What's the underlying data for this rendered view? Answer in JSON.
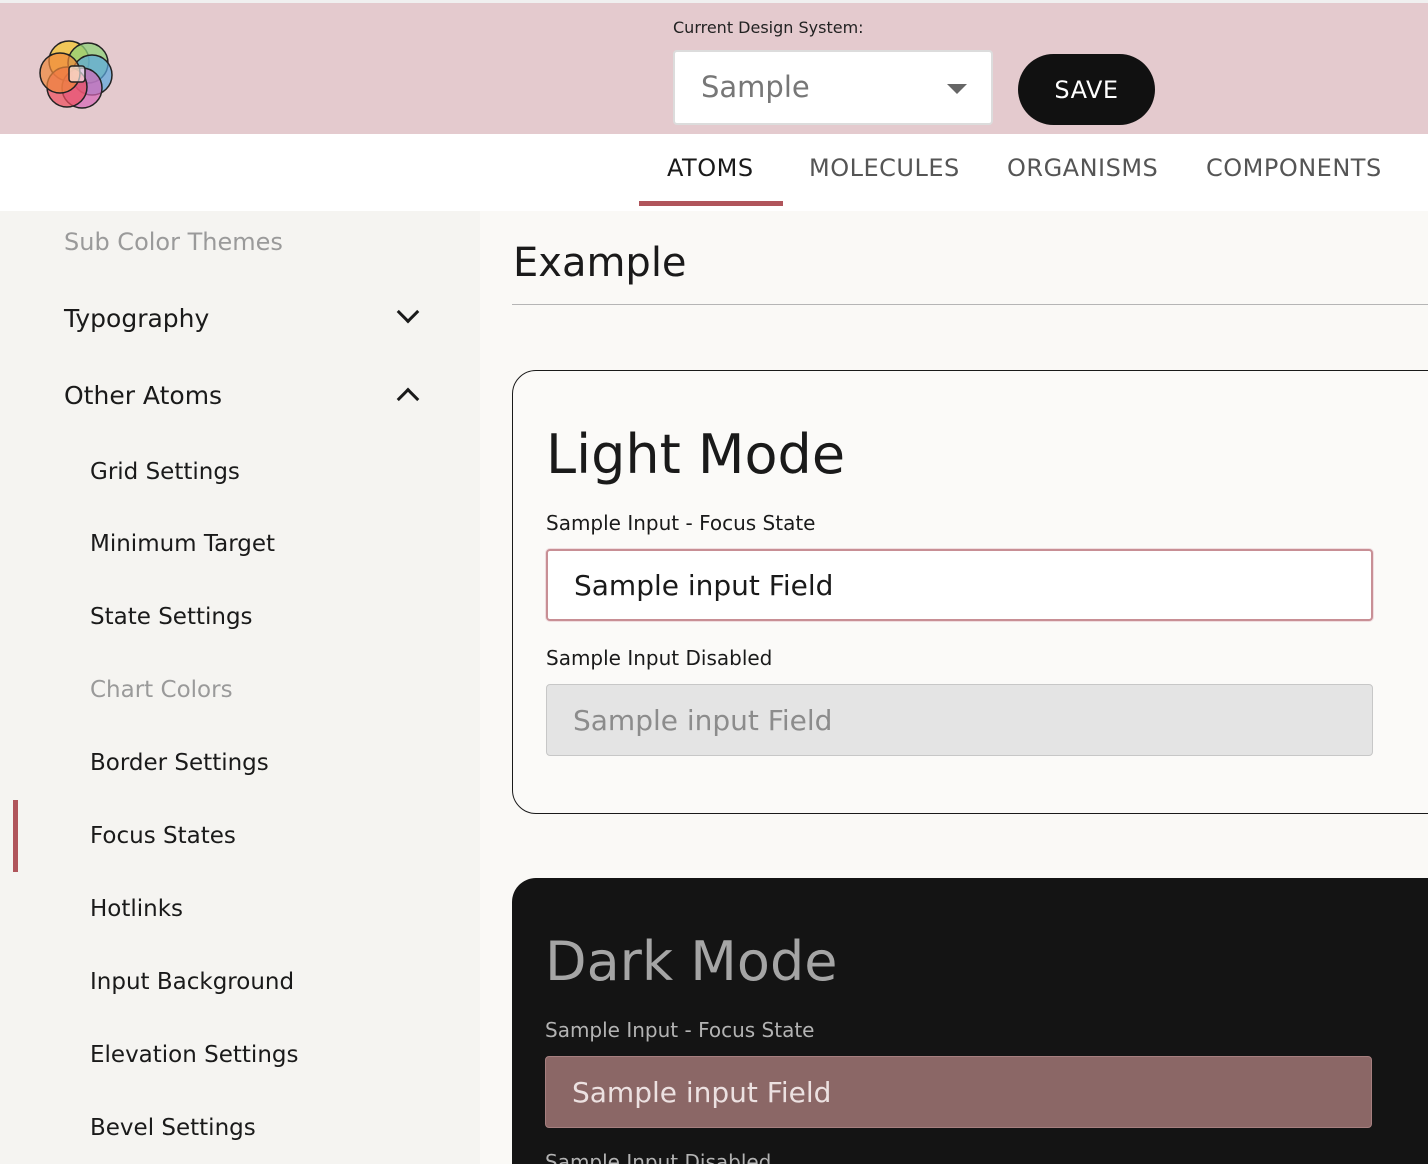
{
  "header": {
    "design_system_label": "Current Design System:",
    "design_system_value": "Sample",
    "save_label": "SAVE"
  },
  "tabs": [
    {
      "label": "ATOMS",
      "active": true
    },
    {
      "label": "MOLECULES",
      "active": false
    },
    {
      "label": "ORGANISMS",
      "active": false
    },
    {
      "label": "COMPONENTS",
      "active": false
    }
  ],
  "sidebar": {
    "top_item": "Sub Color Themes",
    "groups": [
      {
        "label": "Typography",
        "expanded": false
      },
      {
        "label": "Other Atoms",
        "expanded": true
      }
    ],
    "items": [
      {
        "label": "Grid Settings"
      },
      {
        "label": "Minimum Target"
      },
      {
        "label": "State Settings"
      },
      {
        "label": "Chart Colors",
        "muted": true
      },
      {
        "label": "Border Settings"
      },
      {
        "label": "Focus States",
        "active": true
      },
      {
        "label": "Hotlinks"
      },
      {
        "label": "Input Background"
      },
      {
        "label": "Elevation Settings"
      },
      {
        "label": "Bevel Settings"
      }
    ]
  },
  "main": {
    "title": "Example",
    "light": {
      "title": "Light Mode",
      "focus_label": "Sample Input - Focus State",
      "focus_value": "Sample input Field",
      "disabled_label": "Sample Input Disabled",
      "disabled_value": "Sample input Field"
    },
    "dark": {
      "title": "Dark Mode",
      "focus_label": "Sample Input - Focus State",
      "focus_value": "Sample input Field",
      "disabled_label": "Sample Input Disabled"
    }
  },
  "colors": {
    "header_bg": "#e4cace",
    "accent": "#b0555b",
    "save_bg": "#111111",
    "dark_card_bg": "#141414",
    "dark_focus_field": "#8b6766"
  }
}
